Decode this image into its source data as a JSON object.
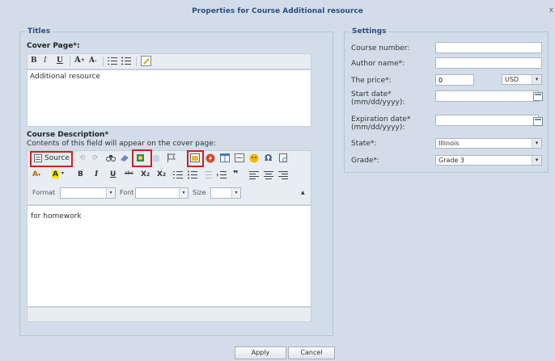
{
  "dialog": {
    "title": "Properties for Course Additional resource",
    "close": "x"
  },
  "titles": {
    "legend": "Titles",
    "cover_label": "Cover Page*:",
    "cover_toolbar": [
      "B",
      "I",
      "U",
      "A",
      "A",
      "ordered-list",
      "unordered-list",
      "edit"
    ],
    "cover_text": "Additional resource",
    "desc_label": "Course Description*",
    "desc_hint": "Contents of this field will appear on the cover page:",
    "source_label": "Source",
    "format_label": "Format",
    "font_label": "Font",
    "size_label": "Size",
    "desc_text": "for homework"
  },
  "settings": {
    "legend": "Settings",
    "course_number_label": "Course number:",
    "author_label": "Author name*:",
    "price_label": "The price*:",
    "price_value": "0",
    "currency": "USD",
    "start_label": "Start date*",
    "start_label2": "(mm/dd/yyyy):",
    "exp_label": "Expiration date*",
    "exp_label2": "(mm/dd/yyyy):",
    "state_label": "State*:",
    "state_value": "Illinois",
    "grade_label": "Grade*:",
    "grade_value": "Grade 3"
  },
  "buttons": {
    "apply": "Apply",
    "cancel": "Cancel"
  },
  "colors": {
    "highlight": "#d32020",
    "accent": "#2a4d80"
  }
}
